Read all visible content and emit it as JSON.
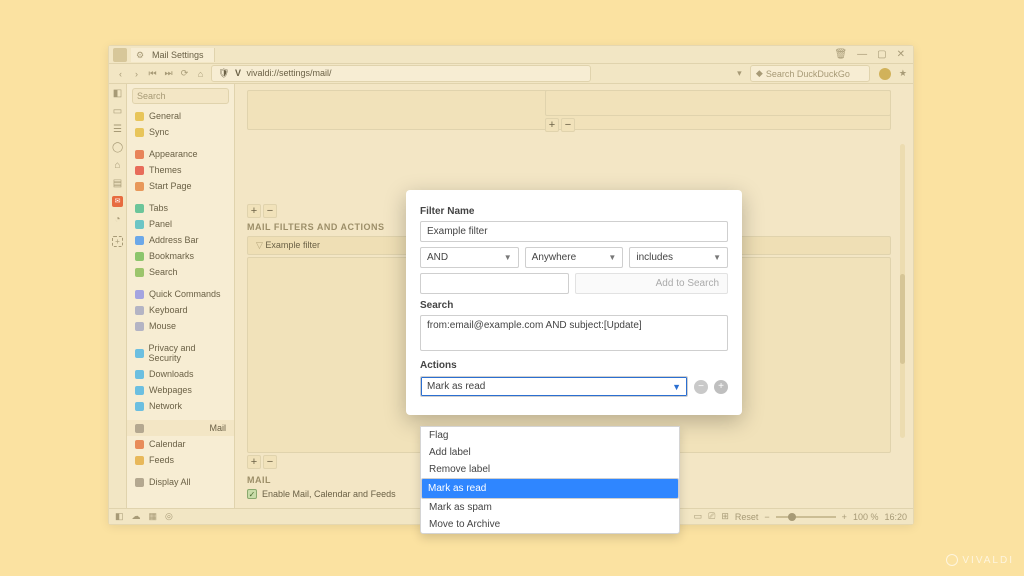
{
  "tab": {
    "title": "Mail Settings"
  },
  "window_buttons": {
    "min": "—",
    "max": "▢",
    "close": "✕"
  },
  "trash_icon": "🗑",
  "addr": {
    "url": "vivaldi://settings/mail/",
    "shield": "🛡",
    "v": "V",
    "search_placeholder": "Search DuckDuckGo"
  },
  "rail_icons": [
    "◧",
    "▭",
    "☰",
    "◯",
    "⌂",
    "▤",
    "✉",
    "◔",
    "⊞"
  ],
  "side": {
    "search_placeholder": "Search",
    "items": [
      {
        "label": "General",
        "cls": "c-gen"
      },
      {
        "label": "Sync",
        "cls": "c-sync"
      },
      {
        "label": "Appearance",
        "cls": "c-app",
        "gap": true
      },
      {
        "label": "Themes",
        "cls": "c-thm"
      },
      {
        "label": "Start Page",
        "cls": "c-sp"
      },
      {
        "label": "Tabs",
        "cls": "c-tabs",
        "gap": true
      },
      {
        "label": "Panel",
        "cls": "c-pnl"
      },
      {
        "label": "Address Bar",
        "cls": "c-adr"
      },
      {
        "label": "Bookmarks",
        "cls": "c-bmk"
      },
      {
        "label": "Search",
        "cls": "c-srh"
      },
      {
        "label": "Quick Commands",
        "cls": "c-qc",
        "gap": true
      },
      {
        "label": "Keyboard",
        "cls": "c-kb"
      },
      {
        "label": "Mouse",
        "cls": "c-ms"
      },
      {
        "label": "Privacy and Security",
        "cls": "c-ps",
        "gap": true
      },
      {
        "label": "Downloads",
        "cls": "c-dl"
      },
      {
        "label": "Webpages",
        "cls": "c-wp"
      },
      {
        "label": "Network",
        "cls": "c-nw"
      },
      {
        "label": "Mail",
        "cls": "c-ml",
        "gap": true,
        "selected": true
      },
      {
        "label": "Calendar",
        "cls": "c-cal"
      },
      {
        "label": "Feeds",
        "cls": "c-fd"
      },
      {
        "label": "Display All",
        "cls": "c-da",
        "gap": true
      }
    ]
  },
  "main": {
    "filters_heading": "MAIL FILTERS AND ACTIONS",
    "example_filter": "Example filter",
    "mail_heading": "MAIL",
    "enable_label": "Enable Mail, Calendar and Feeds"
  },
  "modal": {
    "name_label": "Filter Name",
    "name_value": "Example filter",
    "logic": "AND",
    "scope": "Anywhere",
    "match": "includes",
    "add_to_search": "Add to Search",
    "search_label": "Search",
    "search_value": "from:email@example.com AND subject:[Update]",
    "actions_label": "Actions",
    "action_selected": "Mark as read",
    "options": [
      "Flag",
      "Add label",
      "Remove label",
      "Mark as read",
      "Mark as spam",
      "Move to Archive"
    ]
  },
  "status": {
    "reset": "Reset",
    "zoom": "100 %",
    "time": "16:20"
  },
  "watermark": "VIVALDI"
}
